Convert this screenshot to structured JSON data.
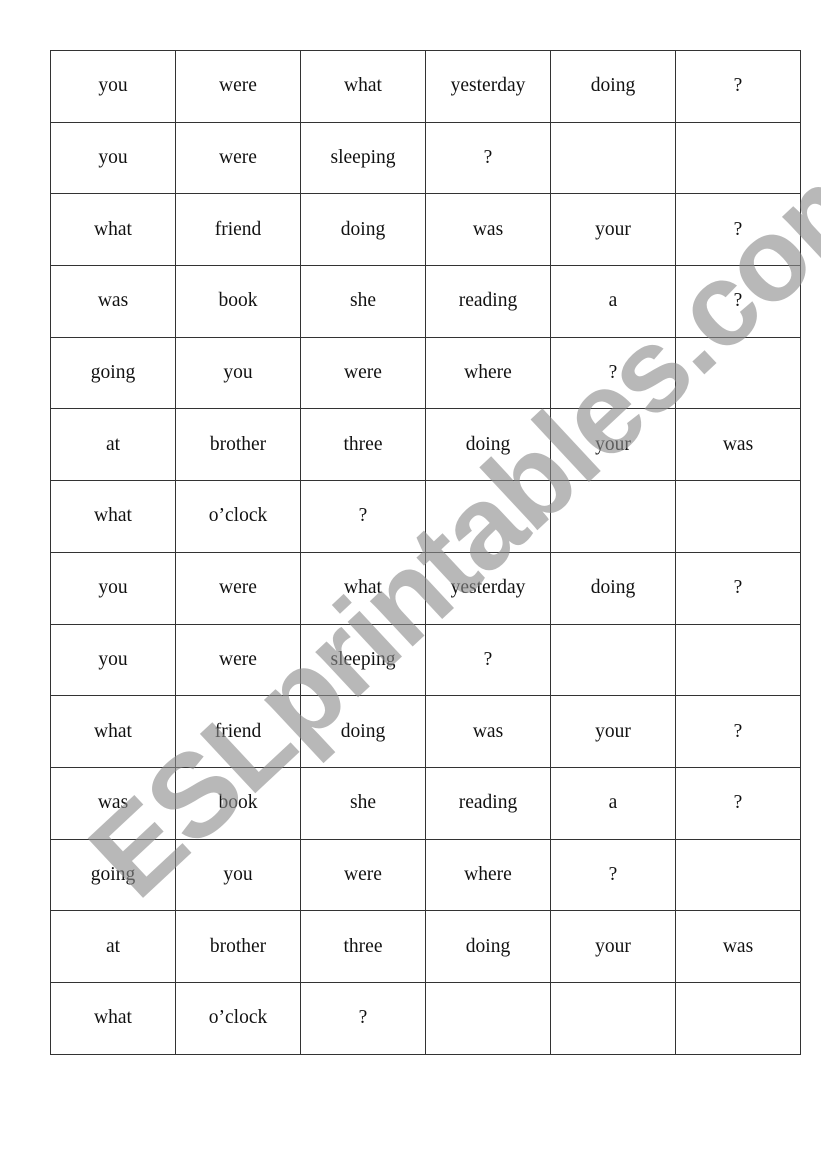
{
  "table": {
    "rows": [
      [
        "you",
        "were",
        "what",
        "yesterday",
        "doing",
        "?"
      ],
      [
        "you",
        "were",
        "sleeping",
        "?",
        "",
        ""
      ],
      [
        "what",
        "friend",
        "doing",
        "was",
        "your",
        "?"
      ],
      [
        "was",
        "book",
        "she",
        "reading",
        "a",
        "?"
      ],
      [
        "going",
        "you",
        "were",
        "where",
        "?",
        ""
      ],
      [
        "at",
        "brother",
        "three",
        "doing",
        "your",
        "was"
      ],
      [
        "what",
        "o’clock",
        "?",
        "",
        "",
        ""
      ],
      [
        "you",
        "were",
        "what",
        "yesterday",
        "doing",
        "?"
      ],
      [
        "you",
        "were",
        "sleeping",
        "?",
        "",
        ""
      ],
      [
        "what",
        "friend",
        "doing",
        "was",
        "your",
        "?"
      ],
      [
        "was",
        "book",
        "she",
        "reading",
        "a",
        "?"
      ],
      [
        "going",
        "you",
        "were",
        "where",
        "?",
        ""
      ],
      [
        "at",
        "brother",
        "three",
        "doing",
        "your",
        "was"
      ],
      [
        "what",
        "o’clock",
        "?",
        "",
        "",
        ""
      ]
    ]
  },
  "watermark": "ESLprintables.com"
}
